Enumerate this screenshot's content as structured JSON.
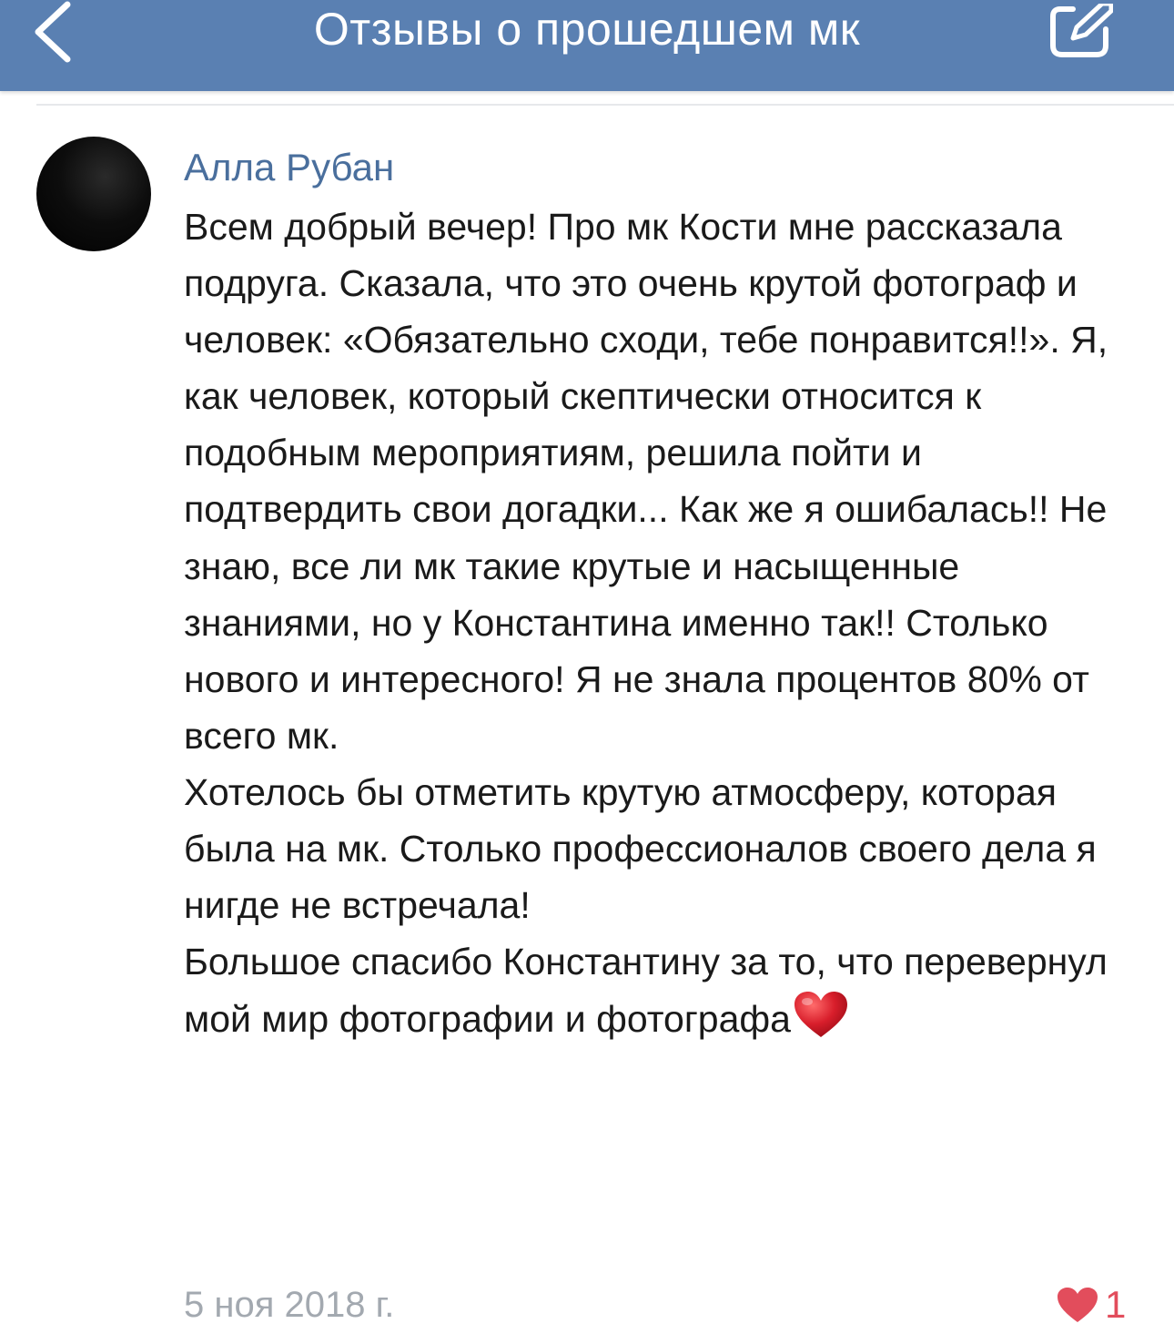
{
  "header": {
    "title": "Отзывы о прошедшем мк",
    "back_icon": "chevron-left-icon",
    "edit_icon": "compose-icon",
    "background_color": "#5a80b2"
  },
  "comment": {
    "author": "Алла Рубан",
    "paragraphs": [
      "Всем добрый вечер! Про мк Кости мне рассказала подруга. Сказала, что это очень крутой фотограф и человек: «Обязательно сходи, тебе понравится!!». Я, как человек, который скептически относится к подобным мероприятиям, решила пойти и подтвердить свои догадки... Как же я ошибалась!! Не знаю, все ли мк такие крутые и насыщенные знаниями, но у Константина именно так!! Столько нового и интересного! Я не знала процентов 80% от всего мк.",
      "Хотелось бы отметить крутую атмосферу, которая была на мк. Столько профессионалов своего дела я нигде не встречала!",
      "Большое спасибо Константину за то, что перевернул мой мир фотографии и фотографа"
    ],
    "emoji": "heart-emoji",
    "date": "5 ноя 2018 г.",
    "likes": "1",
    "like_icon": "heart-icon",
    "like_color": "#e24d5c",
    "author_color": "#4a6f9d"
  }
}
